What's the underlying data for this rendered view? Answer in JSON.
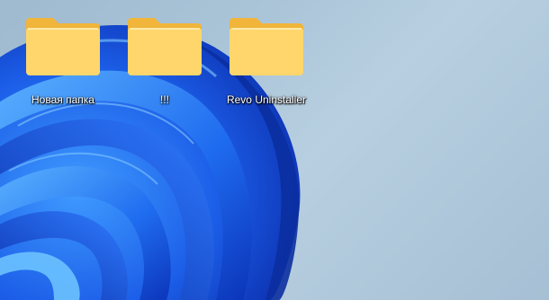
{
  "desktop": {
    "icons": [
      {
        "label": "Новая папка",
        "icon": "folder-icon"
      },
      {
        "label": "!!!",
        "icon": "folder-icon"
      },
      {
        "label": "Revo Uninstaller",
        "icon": "folder-icon"
      }
    ]
  },
  "colors": {
    "background": "#a9c3d7",
    "bloom_dark": "#0a2fb8",
    "bloom_light": "#4aa8ff",
    "folder_front": "#ffd66b",
    "folder_back": "#f3b83a"
  }
}
